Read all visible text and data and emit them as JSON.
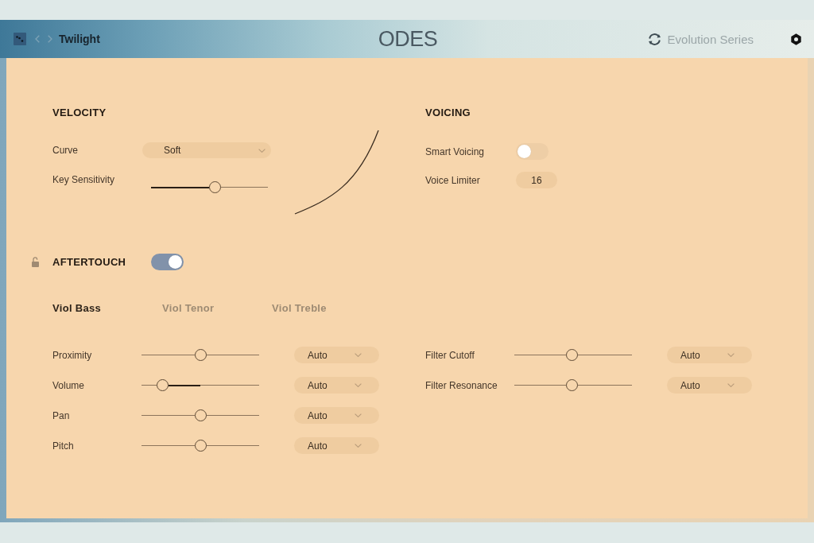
{
  "header": {
    "preset_name": "Twilight",
    "logo": "ODES",
    "product_line": "Evolution Series"
  },
  "velocity": {
    "title": "VELOCITY",
    "curve": {
      "label": "Curve",
      "value": "Soft"
    },
    "key_sensitivity": {
      "label": "Key Sensitivity",
      "level": 0.55
    }
  },
  "voicing": {
    "title": "VOICING",
    "smart_voicing": {
      "label": "Smart Voicing",
      "on": false
    },
    "voice_limiter": {
      "label": "Voice Limiter",
      "value": "16"
    }
  },
  "aftertouch": {
    "title": "AFTERTOUCH",
    "on": true,
    "tabs": [
      {
        "label": "Viol Bass",
        "selected": true
      },
      {
        "label": "Viol Tenor",
        "selected": false
      },
      {
        "label": "Viol Treble",
        "selected": false
      }
    ],
    "params": [
      {
        "label": "Proximity",
        "level": 0.5,
        "mode": "Auto"
      },
      {
        "label": "Volume",
        "level": 0.18,
        "mode": "Auto"
      },
      {
        "label": "Pan",
        "level": 0.5,
        "mode": "Auto"
      },
      {
        "label": "Pitch",
        "level": 0.5,
        "mode": "Auto"
      }
    ],
    "filter_params": [
      {
        "label": "Filter Cutoff",
        "level": 0.49,
        "mode": "Auto"
      },
      {
        "label": "Filter Resonance",
        "level": 0.49,
        "mode": "Auto"
      }
    ]
  }
}
